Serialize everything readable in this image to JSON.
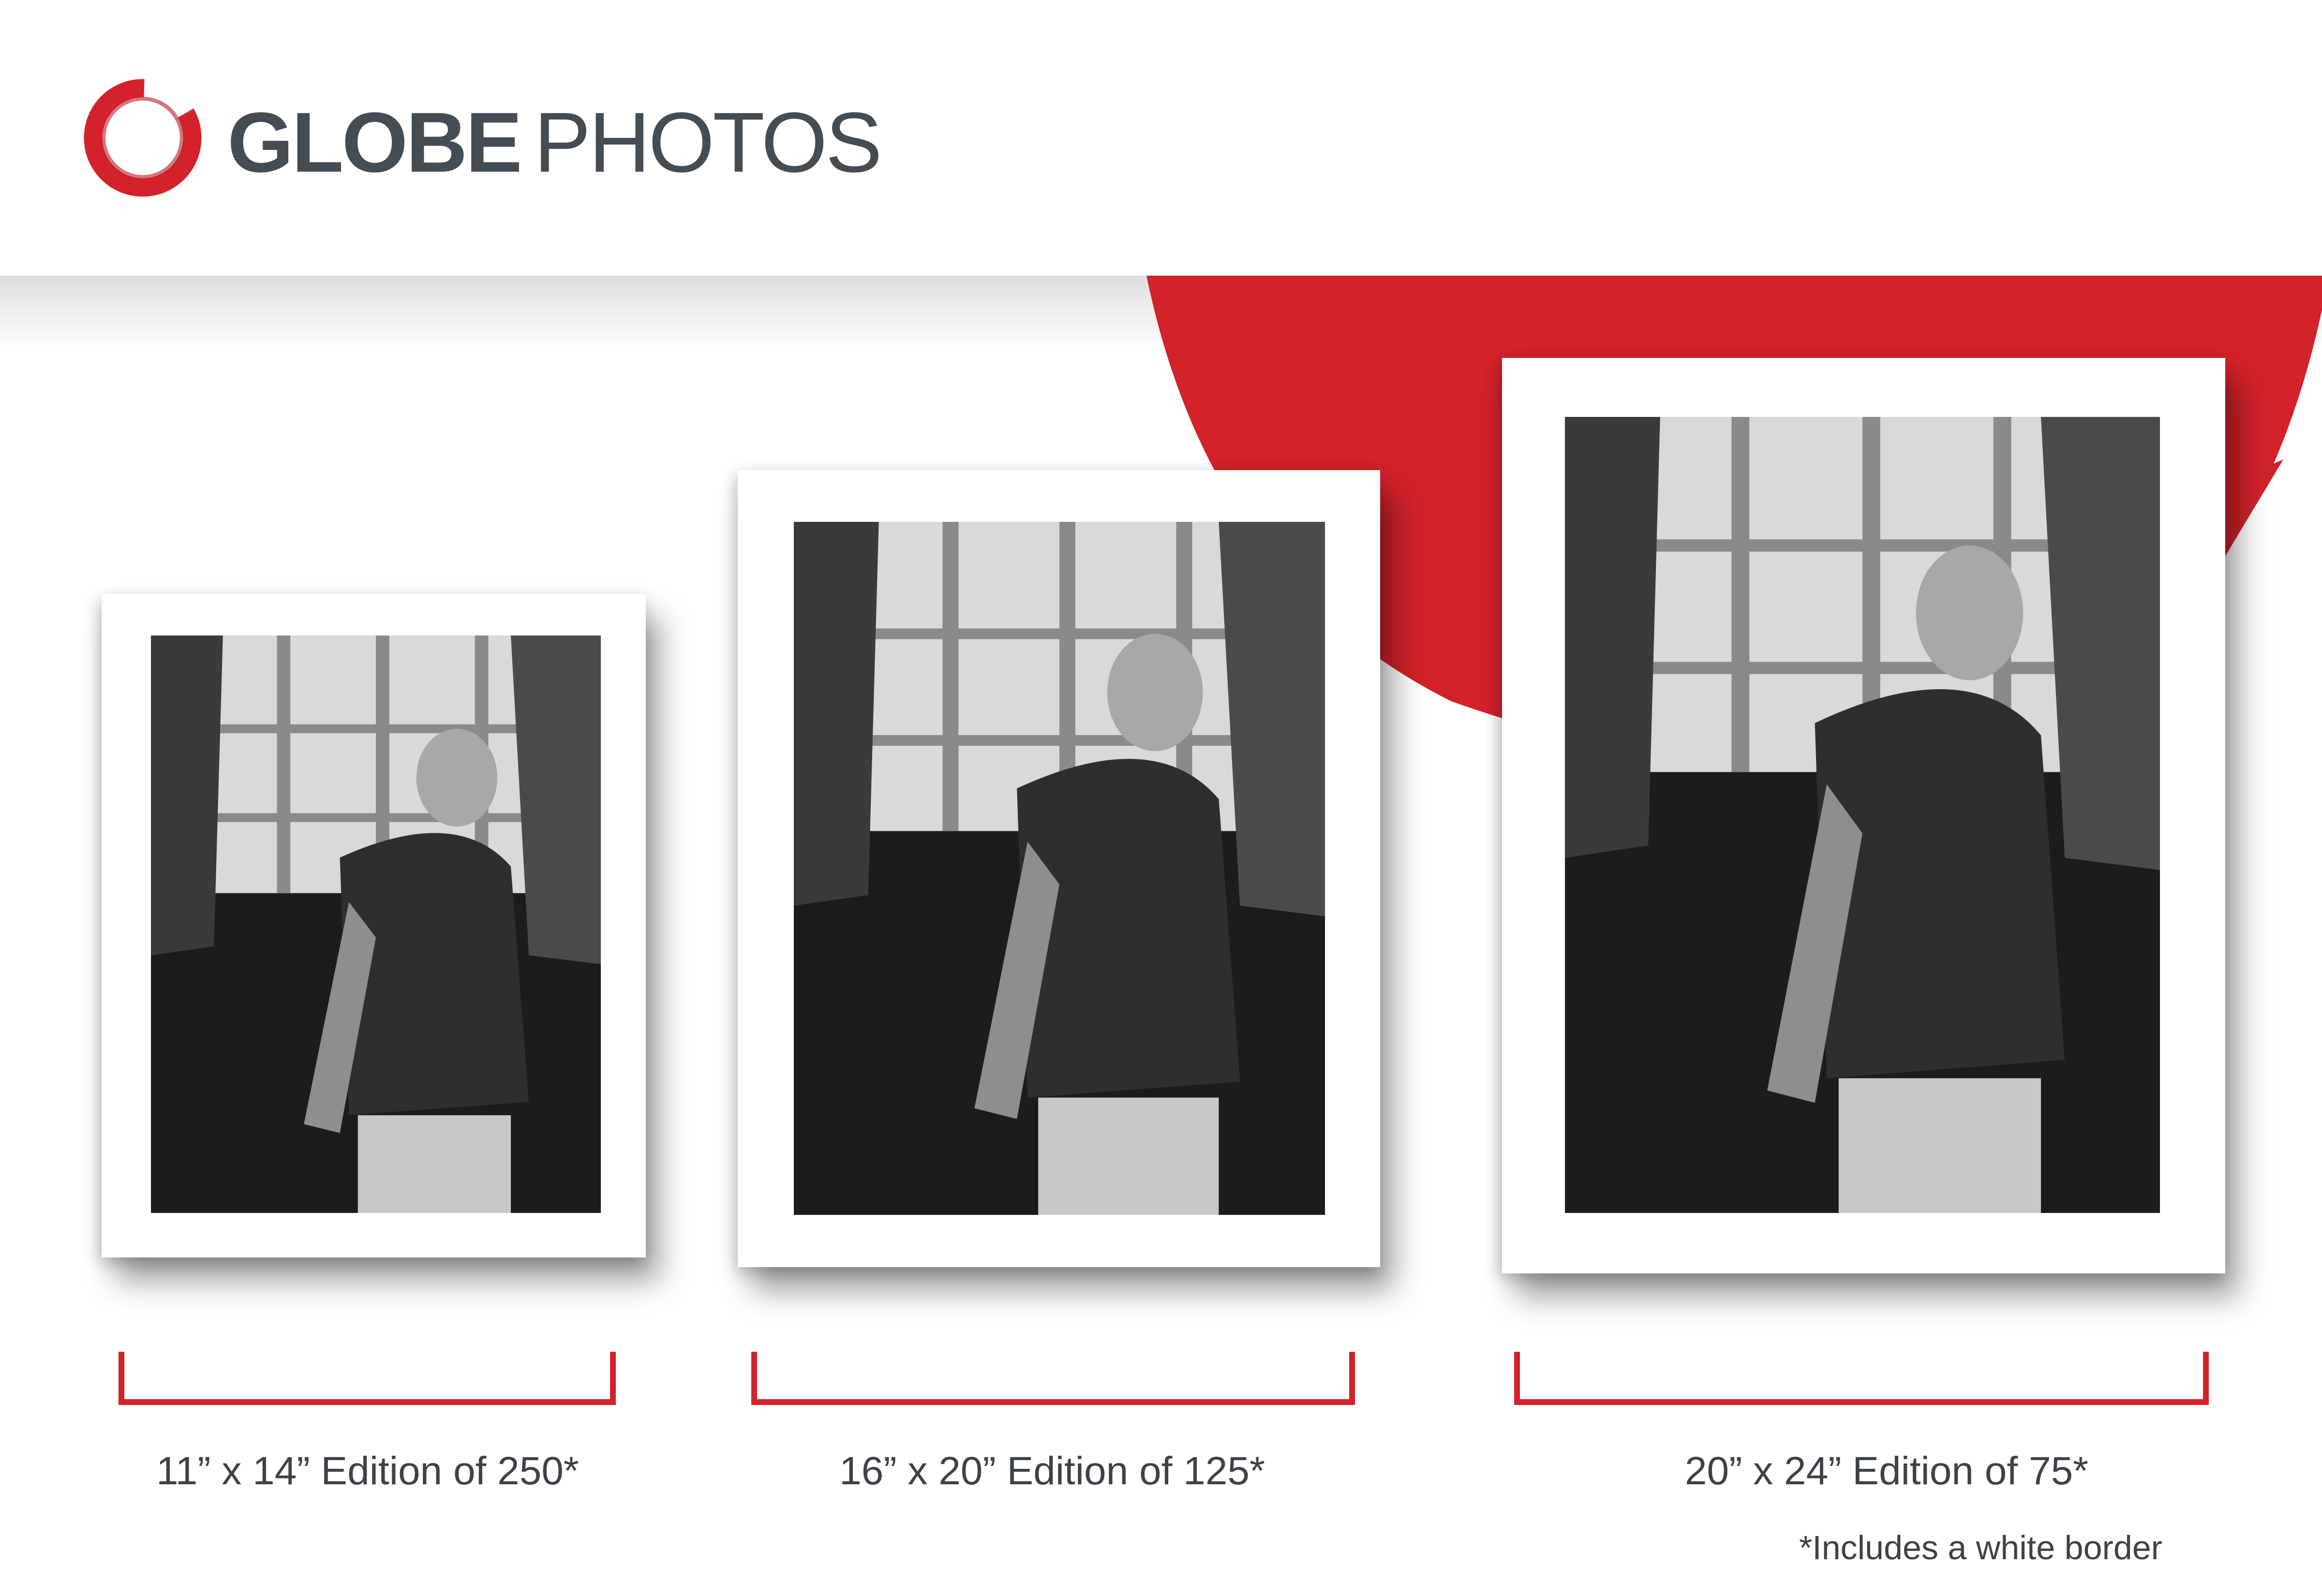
{
  "brand": {
    "name_bold": "GLOBE",
    "name_light": "PHOTOS",
    "accent_color": "#d3222a",
    "text_color": "#444c54"
  },
  "prints": [
    {
      "caption": "11” x 14” Edition of 250*"
    },
    {
      "caption": "16” x 20” Edition of 125*"
    },
    {
      "caption": "20” x 24” Edition of 75*"
    }
  ],
  "footnote": "*Includes a white border"
}
